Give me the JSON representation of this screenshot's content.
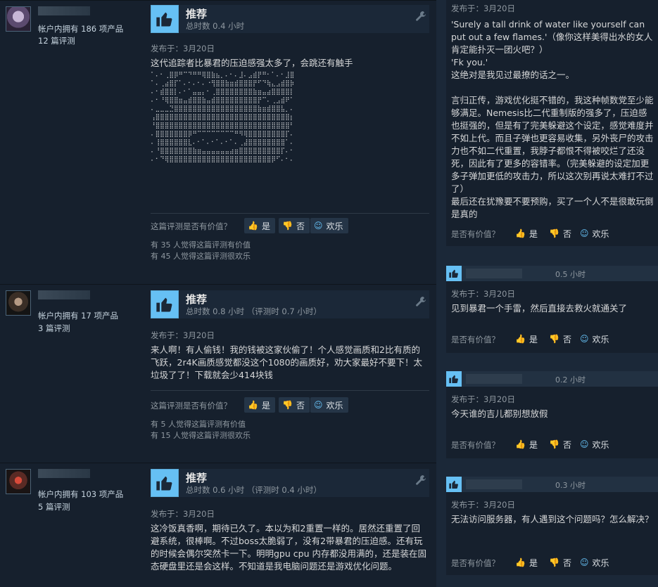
{
  "reviews": [
    {
      "products": "帐户内拥有 186 项产品",
      "review_count": "12 篇评测",
      "vote": "推荐",
      "hours": "总时数 0.4 小时",
      "posted": "发布于：3月20日",
      "text": "这代追踪者比暴君的压迫感强太多了，会跳还有触手",
      "ascii_art": "⠁⠄⠂⢀⣿⡿⠛⠉⠙⠛⠛⢿⣿⣷⣦⡀⠄⠂⠄⣸⠄⣠⣾⡟⠛⠂⠁⠄⠂⣸⣿\n⠁⠄⢀⣴⣿⡏⠁⠄⠂⠄⠂⠄⠐⢻⣿⣿⣷⣶⣾⣿⣿⣿⡟⠋⠙⢷⣄⣠⣾⣿⡷\n⠄⠂⣾⣿⣿⡇⠄⠂⠁⣤⣤⡄⠂⢀⣿⣿⣿⣿⣿⣿⣿⣿⣷⣶⣤⣴⣿⣿⣿⣿⡇\n⠄⠂⠘⢿⣿⣿⣶⣤⣾⣿⣿⣷⣤⣾⣿⣿⣿⣿⣿⣿⣿⣿⣿⡟⠉⠄⢀⣠⣾⠟⠁\n⠄⣀⣀⣀⣙⣿⣿⣿⣿⣿⣿⣿⣿⣿⣿⣿⣿⣿⣿⣿⣿⣿⣿⣷⣶⣾⣿⣿⣧⡀⠄\n⢠⣿⣿⣿⣿⣿⣿⣿⣿⣿⣿⣿⣿⣿⣿⣿⣿⣿⣿⣿⣿⣿⣿⣿⣿⣿⣿⣿⣿⣿⡆\n⠘⣿⣿⣿⣿⣿⣿⣿⣿⣿⣿⣿⣿⣿⣿⣿⣿⣿⣿⣿⣿⣿⣿⣿⣿⣿⣿⣿⣿⣿⠃\n⠄⣿⣿⣿⣿⣿⣿⣿⡿⠛⠉⠉⠉⠉⠉⠉⠉⠉⠛⠻⢿⣿⣿⣿⣿⣿⣿⣿⣿⡏⠄\n⠄⢸⣿⣿⣿⣿⣿⣿⣇⠄⠂⠁⠄⠂⠁⠄⠂⠁⠄⢀⣼⣿⣿⣿⣿⣿⣿⣿⣿⠁⠄\n⠄⠘⣿⣿⣿⣿⣿⣿⣿⣷⣶⣤⣤⣤⣤⣤⣤⣴⣶⣿⣿⣿⣿⣿⣿⣿⣿⣿⡏⠄⠂\n⠄⠂⠙⢿⣿⣿⣿⣿⣿⣿⣿⣿⣿⣿⣿⣿⣿⣿⣿⣿⣿⣿⣿⣿⣿⣿⡿⠋⠄⠂⠄",
      "helpful_q": "这篇评测是否有价值？",
      "yes": "是",
      "no": "否",
      "funny": "欢乐",
      "helpful_count": "有 35 人觉得这篇评测有价值",
      "funny_count": "有 45 人觉得这篇评测很欢乐"
    },
    {
      "products": "帐户内拥有 17 项产品",
      "review_count": "3 篇评测",
      "vote": "推荐",
      "hours": "总时数 0.8 小时 （评测时 0.7 小时）",
      "posted": "发布于：3月20日",
      "text": "来人啊！有人偷钱！我的钱被这家伙偷了！个人感觉画质和2比有质的飞跃，2r4K画质感觉都没这个1080的画质好，劝大家最好不要下！太垃圾了了！下载就会少414块钱",
      "helpful_q": "这篇评测是否有价值？",
      "yes": "是",
      "no": "否",
      "funny": "欢乐",
      "helpful_count": "有 5 人觉得这篇评测有价值",
      "funny_count": "有 15 人觉得这篇评测很欢乐"
    },
    {
      "products": "帐户内拥有 103 项产品",
      "review_count": "5 篇评测",
      "vote": "推荐",
      "hours": "总时数 0.6 小时 （评测时 0.4 小时）",
      "posted": "发布于：3月20日",
      "text": "这冷饭真香啊，期待已久了。本以为和2重置一样的。居然还重置了回避系统，很棒啊。不过boss太脆弱了，没有2带暴君的压迫感。还有玩的时候会偶尔突然卡一下。明明gpu cpu 内存都没用满的，还是装在固态硬盘里还是会这样。不知道是我电脑问题还是游戏优化问题。",
      "helpful_q": "这篇评测是否有价值？",
      "yes": "是",
      "no": "否",
      "funny": "欢乐"
    }
  ],
  "right_reviews": [
    {
      "posted": "发布于：3月20日",
      "text": "'Surely a tall drink of water like yourself can put out a few flames.'（像你这样美得出水的女人肯定能扑灭一团火吧？）\n'Fk you.'\n这绝对是我见过最撩的话之一。\n\n言归正传，游戏优化挺不错的，我这种帧数党至少能够满足。Nemesis比二代重制版的强多了，压迫感也挺强的，但是有了完美躲避这个设定，感觉难度并不如上代。而且子弹也更容易收集，另外丧尸的攻击力也不如二代重置，我脖子都恨不得被咬烂了还没死，因此有了更多的容错率。（完美躲避的设定加更多子弹加更低的攻击力，所以这次别再说太难打不过了）\n最后还在犹豫要不要预购，买了一个人不是很敢玩倒是真的",
      "helpful_q": "是否有价值？",
      "yes": "是",
      "no": "否",
      "funny": "欢乐"
    },
    {
      "hours": "0.5 小时",
      "posted": "发布于：3月20日",
      "text": "见到暴君一个手雷，然后直接去救火就通关了",
      "helpful_q": "是否有价值？",
      "yes": "是",
      "no": "否",
      "funny": "欢乐"
    },
    {
      "hours": "0.2 小时",
      "posted": "发布于：3月20日",
      "text": "今天谁的吉儿都别想放假",
      "helpful_q": "是否有价值？",
      "yes": "是",
      "no": "否",
      "funny": "欢乐"
    },
    {
      "hours": "0.3 小时",
      "posted": "发布于：3月20日",
      "text": "无法访问服务器，有人遇到这个问题吗？怎么解决？",
      "helpful_q": "是否有价值？",
      "yes": "是",
      "no": "否",
      "funny": "欢乐"
    }
  ],
  "icons": {
    "thumb": "thumbs-up-icon",
    "thumb_down": "thumbs-down-icon",
    "funny": "smiley-icon",
    "wrench": "wrench-icon"
  },
  "colors": {
    "accent": "#66c0f4",
    "background": "#1b2838",
    "card": "#16202d"
  }
}
